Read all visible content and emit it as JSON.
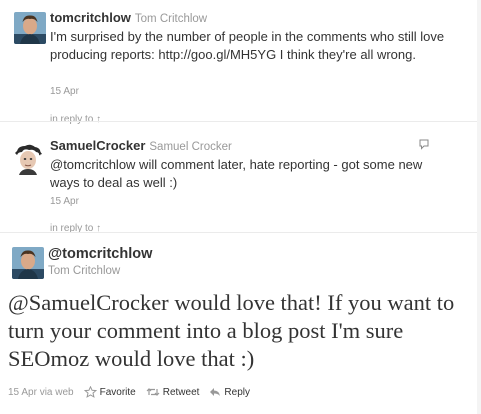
{
  "tweets": [
    {
      "handle": "tomcritchlow",
      "name": "Tom Critchlow",
      "text_before_link": "I'm surprised by the number of people in the comments who still love producing reports: ",
      "link": "http://goo.gl/MH5YG",
      "text_after_link": " I think they're all wrong.",
      "date": "15 Apr"
    },
    {
      "handle": "SamuelCrocker",
      "name": "Samuel Crocker",
      "mention": "@tomcritchlow",
      "text": " will comment later, hate reporting - got some new ways to deal as well :)",
      "date": "15 Apr"
    }
  ],
  "in_reply_to_label": "in reply to ↑",
  "focused_tweet": {
    "handle": "@tomcritchlow",
    "name": "Tom Critchlow",
    "mention": "@SamuelCrocker",
    "text": " would love that! If you want to turn your comment into a blog post I'm sure SEOmoz would love that :)",
    "date": "15 Apr",
    "via": "via web",
    "actions": {
      "favorite": "Favorite",
      "retweet": "Retweet",
      "reply": "Reply"
    }
  },
  "colors": {
    "text": "#333333",
    "muted": "#999999",
    "divider": "#ebebeb"
  },
  "icons": [
    "reply-icon",
    "star-icon",
    "retweet-icon",
    "reply-arrow-icon"
  ]
}
